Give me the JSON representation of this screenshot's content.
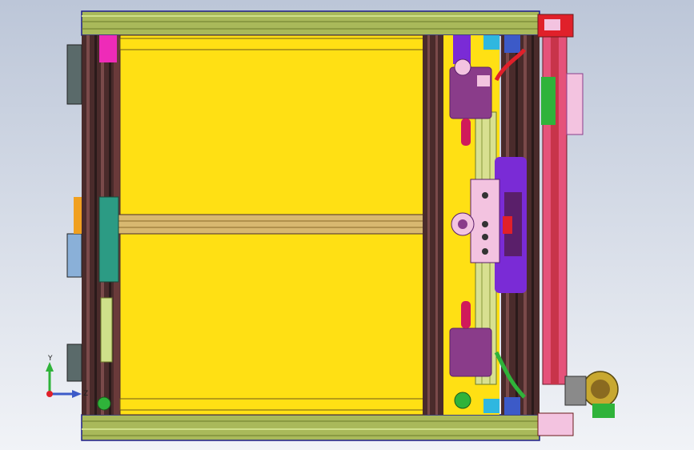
{
  "viewport": {
    "background_top": "#bcc6d8",
    "background_bottom": "#f1f3f7"
  },
  "colors": {
    "frame_outer": "#1c1c8a",
    "frame_green": "#a9b95a",
    "frame_green_light": "#cfe08a",
    "frame_green_dark": "#6c7a2a",
    "panel_yellow": "#ffe014",
    "extrusion_dark": "#4a2b2b",
    "extrusion_mid": "#7a4a4a",
    "rail_red": "#c8344a",
    "purple": "#8a3c8a",
    "purple_dark": "#5a1f6a",
    "violet": "#7a2bd6",
    "pink": "#f3c3e0",
    "magenta": "#ee2bb8",
    "teal": "#2c9b84",
    "green": "#2fb33a",
    "red": "#e0202a",
    "blue": "#3c5ac8",
    "light_blue": "#8ab0d8",
    "cyan": "#2fb7e0",
    "orange": "#f0a020",
    "gray": "#8a8a8a"
  },
  "triad": {
    "y_label": "Y",
    "z_label": "Z",
    "y_color": "#2fb33a",
    "z_color": "#3c5ac8",
    "x_color": "#e0202a"
  }
}
